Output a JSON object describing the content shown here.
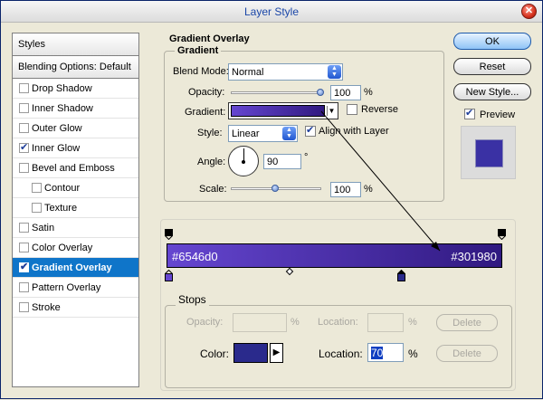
{
  "window": {
    "title": "Layer Style"
  },
  "styles_panel": {
    "header": "Styles",
    "blending_options": "Blending Options: Default",
    "items": [
      {
        "label": "Drop Shadow",
        "checked": false,
        "sub": false,
        "selected": false
      },
      {
        "label": "Inner Shadow",
        "checked": false,
        "sub": false,
        "selected": false
      },
      {
        "label": "Outer Glow",
        "checked": false,
        "sub": false,
        "selected": false
      },
      {
        "label": "Inner Glow",
        "checked": true,
        "sub": false,
        "selected": false
      },
      {
        "label": "Bevel and Emboss",
        "checked": false,
        "sub": false,
        "selected": false
      },
      {
        "label": "Contour",
        "checked": false,
        "sub": true,
        "selected": false
      },
      {
        "label": "Texture",
        "checked": false,
        "sub": true,
        "selected": false
      },
      {
        "label": "Satin",
        "checked": false,
        "sub": false,
        "selected": false
      },
      {
        "label": "Color Overlay",
        "checked": false,
        "sub": false,
        "selected": false
      },
      {
        "label": "Gradient Overlay",
        "checked": true,
        "sub": false,
        "selected": true
      },
      {
        "label": "Pattern Overlay",
        "checked": false,
        "sub": false,
        "selected": false
      },
      {
        "label": "Stroke",
        "checked": false,
        "sub": false,
        "selected": false
      }
    ]
  },
  "gradient_overlay": {
    "section_title": "Gradient Overlay",
    "group_title": "Gradient",
    "blend_mode_label": "Blend Mode:",
    "blend_mode_value": "Normal",
    "opacity_label": "Opacity:",
    "opacity_value": "100",
    "opacity_unit": "%",
    "opacity_level": 1.0,
    "gradient_label": "Gradient:",
    "reverse_label": "Reverse",
    "reverse_checked": false,
    "style_label": "Style:",
    "style_value": "Linear",
    "align_label": "Align with Layer",
    "align_checked": true,
    "angle_label": "Angle:",
    "angle_value": "90",
    "angle_unit": "°",
    "scale_label": "Scale:",
    "scale_value": "100",
    "scale_unit": "%",
    "scale_level": 0.5
  },
  "gradient_editor": {
    "start_color_label": "#6546d0",
    "end_color_label": "#301980",
    "start_color": "#6546d0",
    "end_color": "#301980",
    "color_stop_position": 0.7,
    "stops": {
      "title": "Stops",
      "opacity_label": "Opacity:",
      "opacity_unit": "%",
      "location_label_1": "Location:",
      "location_unit_1": "%",
      "delete_label_1": "Delete",
      "color_label": "Color:",
      "color_swatch": "#2a2a8c",
      "location_label_2": "Location:",
      "location_value": "70",
      "location_unit_2": "%",
      "delete_label_2": "Delete"
    }
  },
  "buttons": {
    "ok": "OK",
    "reset": "Reset",
    "new_style": "New Style...",
    "preview_label": "Preview",
    "preview_checked": true
  },
  "preview": {
    "swatch_color": "#3a31a4"
  }
}
